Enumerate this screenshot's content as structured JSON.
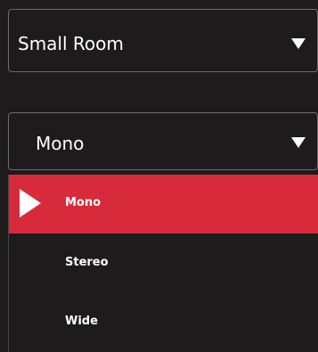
{
  "room_select": {
    "value": "Small Room",
    "icon": "chevron-down-icon"
  },
  "mode_select": {
    "value": "Mono",
    "icon": "chevron-down-icon",
    "options": [
      {
        "label": "Mono",
        "selected": true
      },
      {
        "label": "Stereo",
        "selected": false
      },
      {
        "label": "Wide",
        "selected": false
      }
    ],
    "selected_marker_icon": "play-icon"
  },
  "colors": {
    "background": "#1e1b1c",
    "border": "#6f6b6c",
    "accent": "#d72b3b",
    "text": "#ffffff"
  }
}
